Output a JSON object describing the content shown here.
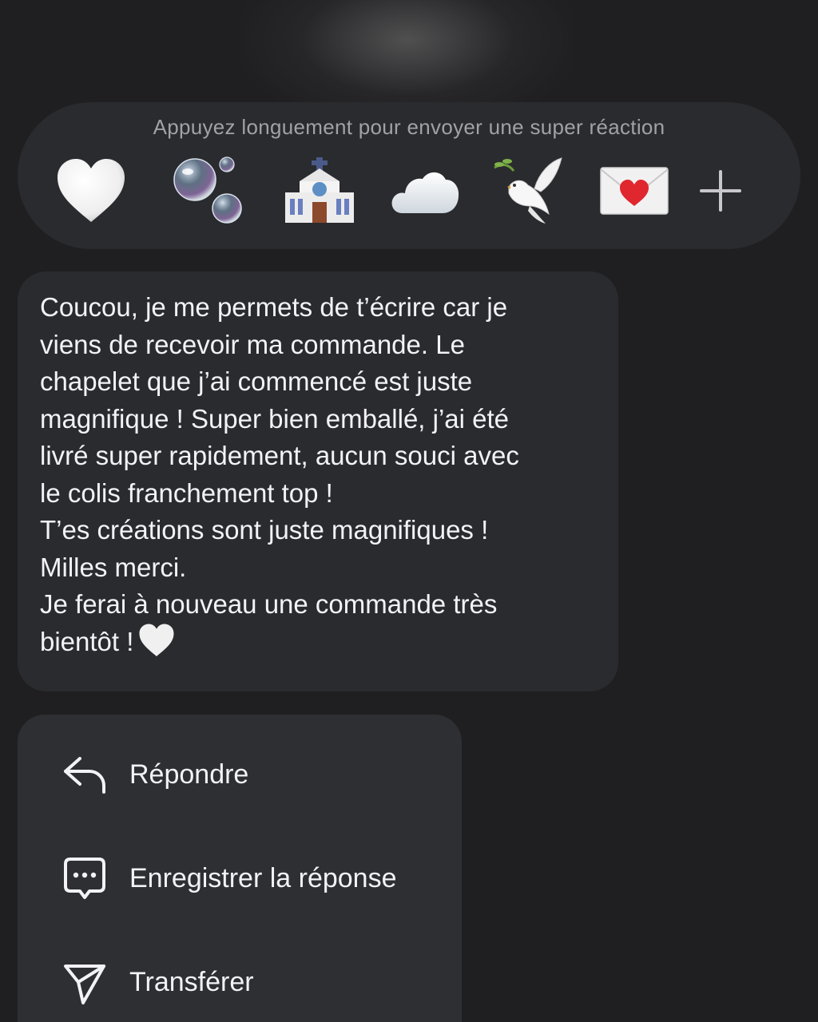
{
  "reactions": {
    "hint": "Appuyez longuement pour envoyer une super réaction",
    "items": [
      {
        "icon": "white-heart-emoji"
      },
      {
        "icon": "bubbles-emoji"
      },
      {
        "icon": "church-emoji"
      },
      {
        "icon": "cloud-emoji"
      },
      {
        "icon": "dove-emoji"
      },
      {
        "icon": "love-letter-emoji"
      },
      {
        "icon": "plus-icon"
      }
    ]
  },
  "message": {
    "text": "Coucou, je me permets de t’écrire car je\nviens de recevoir ma commande. Le\nchapelet que j’ai commencé est juste\nmagnifique ! Super bien emballé, j’ai été\nlivré super rapidement, aucun souci avec\nle colis franchement top !\nT’es créations sont juste magnifiques !\nMilles merci.\nJe ferai à nouveau une commande très\nbientôt !",
    "trailing_icon": "white-heart-emoji"
  },
  "menu": {
    "items": [
      {
        "label": "Répondre",
        "icon": "reply-icon"
      },
      {
        "label": "Enregistrer la réponse",
        "icon": "saved-reply-icon"
      },
      {
        "label": "Transférer",
        "icon": "send-icon"
      }
    ]
  },
  "colors": {
    "background": "#1f1f21",
    "panel": "#2a2b2e",
    "text": "#f2f2f7",
    "hint": "#a1a1a6"
  }
}
